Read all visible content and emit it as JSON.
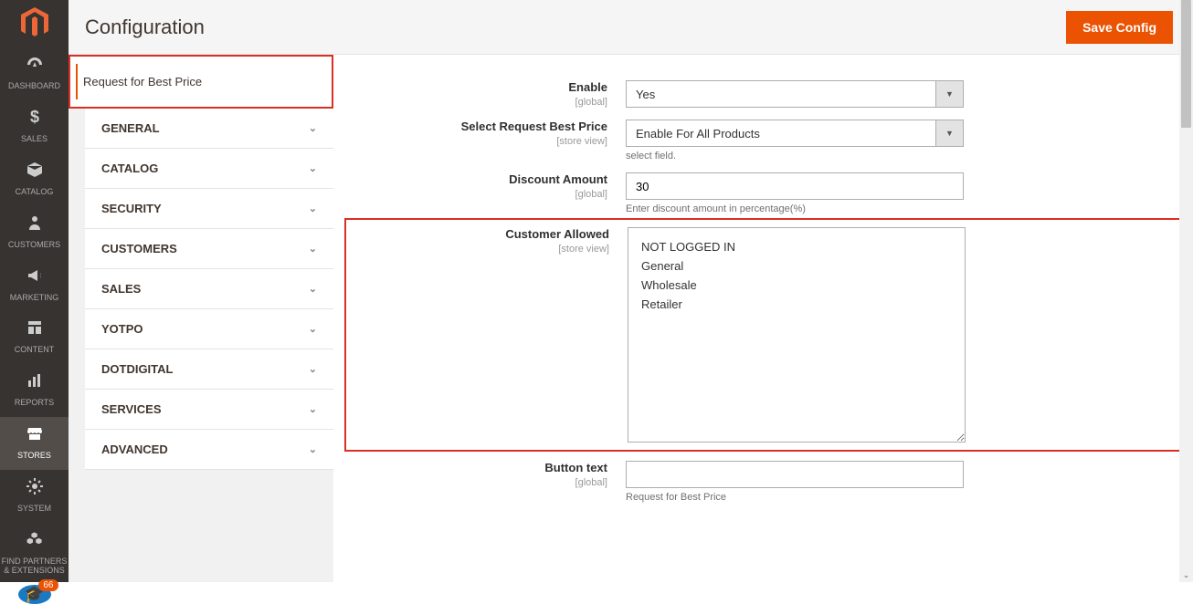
{
  "page": {
    "title": "Configuration"
  },
  "header": {
    "save_label": "Save Config"
  },
  "nav": {
    "items": [
      {
        "label": "DASHBOARD",
        "icon": "dashboard"
      },
      {
        "label": "SALES",
        "icon": "dollar"
      },
      {
        "label": "CATALOG",
        "icon": "box"
      },
      {
        "label": "CUSTOMERS",
        "icon": "person"
      },
      {
        "label": "MARKETING",
        "icon": "megaphone"
      },
      {
        "label": "CONTENT",
        "icon": "layout"
      },
      {
        "label": "REPORTS",
        "icon": "bars"
      },
      {
        "label": "STORES",
        "icon": "storefront"
      },
      {
        "label": "SYSTEM",
        "icon": "gear"
      },
      {
        "label": "FIND PARTNERS & EXTENSIONS",
        "icon": "boxes"
      }
    ],
    "help_badge": "66"
  },
  "config_sidebar": {
    "active": "Request for Best Price",
    "items": [
      "GENERAL",
      "CATALOG",
      "SECURITY",
      "CUSTOMERS",
      "SALES",
      "YOTPO",
      "DOTDIGITAL",
      "SERVICES",
      "ADVANCED"
    ]
  },
  "form": {
    "enable": {
      "label": "Enable",
      "scope": "[global]",
      "value": "Yes"
    },
    "select_request": {
      "label": "Select Request Best Price",
      "scope": "[store view]",
      "value": "Enable For All Products",
      "help": "select field."
    },
    "discount": {
      "label": "Discount Amount",
      "scope": "[global]",
      "value": "30",
      "help": "Enter discount amount in percentage(%)"
    },
    "customer_allowed": {
      "label": "Customer Allowed",
      "scope": "[store view]",
      "options": [
        "NOT LOGGED IN",
        "General",
        "Wholesale",
        "Retailer"
      ]
    },
    "button_text": {
      "label": "Button text",
      "scope": "[global]",
      "value": "",
      "help": "Request for Best Price"
    }
  }
}
